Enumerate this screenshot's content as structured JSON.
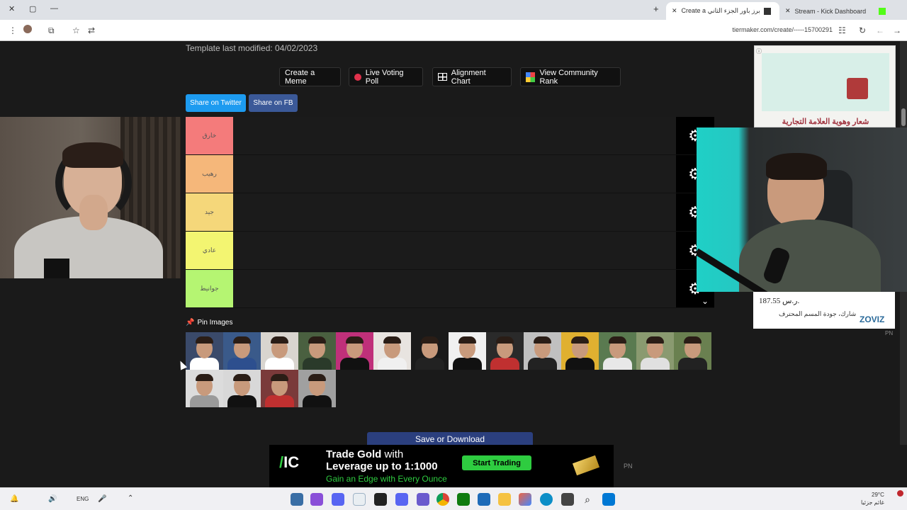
{
  "browser": {
    "tabs": [
      {
        "label": "Create a يوتيوبرز باور الجزء الثاني",
        "active": true
      },
      {
        "label": "Stream - Kick Dashboard",
        "active": false
      }
    ],
    "url": "tiermaker.com/create/-----15700291",
    "new_tab_symbol": "+",
    "close_symbol": "✕"
  },
  "page": {
    "modified_text": "Template last modified: 04/02/2023",
    "buttons": {
      "create_meme": "Create a Meme",
      "live_poll": "Live Voting Poll",
      "alignment": "Alignment Chart",
      "community": "View Community Rank"
    },
    "share": {
      "twitter": "Share on Twitter",
      "fb": "Share on FB"
    },
    "tiers": [
      {
        "label": "خارق",
        "color": "#f47b7b"
      },
      {
        "label": "رهيب",
        "color": "#f5b77a"
      },
      {
        "label": "جيد",
        "color": "#f5d77a"
      },
      {
        "label": "عادي",
        "color": "#f3f571"
      },
      {
        "label": "جوانيط",
        "color": "#b5f572"
      }
    ],
    "pin_label": "Pin Images",
    "save_label": "Save or Download"
  },
  "thumbs": [
    {
      "bg": "#3a4a6a",
      "shirt": "#ffffff"
    },
    {
      "bg": "#3a5a8a",
      "shirt": "#2d4f8e"
    },
    {
      "bg": "#d9d5cf",
      "shirt": "#ffffff"
    },
    {
      "bg": "#4a6040",
      "shirt": "#2a3a2a"
    },
    {
      "bg": "#c0307a",
      "shirt": "#111111"
    },
    {
      "bg": "#e8e4e0",
      "shirt": "#f0f0f0"
    },
    {
      "bg": "#1a1a1a",
      "shirt": "#222222"
    },
    {
      "bg": "#f0f0f0",
      "shirt": "#111111"
    },
    {
      "bg": "#2a2a2a",
      "shirt": "#c03030"
    },
    {
      "bg": "#c0c0c0",
      "shirt": "#222222"
    },
    {
      "bg": "#e0b030",
      "shirt": "#111111"
    },
    {
      "bg": "#5a7a50",
      "shirt": "#e8e8e8"
    },
    {
      "bg": "#8a9a70",
      "shirt": "#e0e0e0"
    },
    {
      "bg": "#6a8050",
      "shirt": "#222222"
    },
    {
      "bg": "#dcdcdc",
      "shirt": "#9a9a9a"
    },
    {
      "bg": "#d8d8d8",
      "shirt": "#111111"
    },
    {
      "bg": "#7a3a3a",
      "shirt": "#c03030"
    },
    {
      "bg": "#a0a0a0",
      "shirt": "#111111"
    }
  ],
  "ads": {
    "brand_title": "شعار وهوية العلامة التجارية",
    "price": "187.55 ر.س.",
    "product": "شارك، جودة المسم المحترف",
    "brand": "ZOVIZ",
    "trade_line1": "Trade Gold",
    "trade_with": "with",
    "trade_line2": "Leverage up to 1:1000",
    "trade_line3": "Gain an Edge with Every Ounce",
    "trade_button": "Start Trading",
    "pn_label": "PN"
  },
  "taskbar": {
    "lang": "ENG",
    "weather": "29°C",
    "weather_sub": "غائم جزئيا"
  }
}
